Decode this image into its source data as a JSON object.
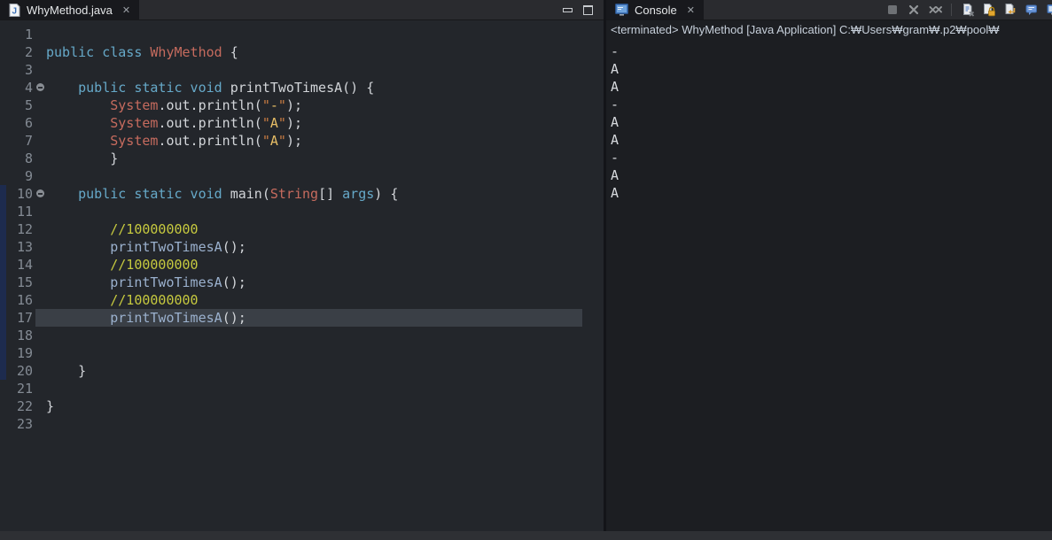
{
  "colors": {
    "keyword": "#66A9C9",
    "type": "#C66B5E",
    "plain": "#D2D5D9",
    "string": "#E7BE66",
    "string_quote": "#C97C43",
    "comment": "#C6C93F",
    "method_call": "#9BB1CE",
    "current_line": "#3A3F46",
    "range_indicator": "#1D2B4E"
  },
  "editor": {
    "tab_title": "WhyMethod.java",
    "tab_close": "✕",
    "window_controls": [
      "minimize",
      "maximize"
    ],
    "highlight_line": 17,
    "range": {
      "from": 10,
      "to": 20
    },
    "lines": [
      {
        "n": 1,
        "tk": []
      },
      {
        "n": 2,
        "tk": [
          [
            "kw",
            "public class "
          ],
          [
            "ty",
            "WhyMethod "
          ],
          [
            "pl",
            "{"
          ]
        ]
      },
      {
        "n": 3,
        "tk": []
      },
      {
        "n": 4,
        "fold": true,
        "tk": [
          [
            "pl",
            "    "
          ],
          [
            "kw",
            "public static void "
          ],
          [
            "pl",
            "printTwoTimesA() {"
          ]
        ]
      },
      {
        "n": 5,
        "tk": [
          [
            "pl",
            "        "
          ],
          [
            "ty",
            "System"
          ],
          [
            "pl",
            ".out.println("
          ],
          [
            "qt",
            "\""
          ],
          [
            "st",
            "-"
          ],
          [
            "qt",
            "\""
          ],
          [
            "pl",
            ");"
          ]
        ]
      },
      {
        "n": 6,
        "tk": [
          [
            "pl",
            "        "
          ],
          [
            "ty",
            "System"
          ],
          [
            "pl",
            ".out.println("
          ],
          [
            "qt",
            "\""
          ],
          [
            "st",
            "A"
          ],
          [
            "qt",
            "\""
          ],
          [
            "pl",
            ");"
          ]
        ]
      },
      {
        "n": 7,
        "tk": [
          [
            "pl",
            "        "
          ],
          [
            "ty",
            "System"
          ],
          [
            "pl",
            ".out.println("
          ],
          [
            "qt",
            "\""
          ],
          [
            "st",
            "A"
          ],
          [
            "qt",
            "\""
          ],
          [
            "pl",
            ");"
          ]
        ]
      },
      {
        "n": 8,
        "tk": [
          [
            "pl",
            "        }"
          ]
        ]
      },
      {
        "n": 9,
        "tk": []
      },
      {
        "n": 10,
        "fold": true,
        "tk": [
          [
            "pl",
            "    "
          ],
          [
            "kw",
            "public static void "
          ],
          [
            "pl",
            "main("
          ],
          [
            "ty",
            "String"
          ],
          [
            "pl",
            "[] "
          ],
          [
            "kw",
            "args"
          ],
          [
            "pl",
            ") {"
          ]
        ]
      },
      {
        "n": 11,
        "tk": []
      },
      {
        "n": 12,
        "tk": [
          [
            "pl",
            "        "
          ],
          [
            "cm",
            "//100000000"
          ]
        ]
      },
      {
        "n": 13,
        "tk": [
          [
            "pl",
            "        "
          ],
          [
            "ca",
            "printTwoTimesA"
          ],
          [
            "pl",
            "();"
          ]
        ]
      },
      {
        "n": 14,
        "tk": [
          [
            "pl",
            "        "
          ],
          [
            "cm",
            "//100000000"
          ]
        ]
      },
      {
        "n": 15,
        "tk": [
          [
            "pl",
            "        "
          ],
          [
            "ca",
            "printTwoTimesA"
          ],
          [
            "pl",
            "();"
          ]
        ]
      },
      {
        "n": 16,
        "tk": [
          [
            "pl",
            "        "
          ],
          [
            "cm",
            "//100000000"
          ]
        ]
      },
      {
        "n": 17,
        "tk": [
          [
            "pl",
            "        "
          ],
          [
            "ca",
            "printTwoTimesA"
          ],
          [
            "pl",
            "();"
          ]
        ]
      },
      {
        "n": 18,
        "tk": []
      },
      {
        "n": 19,
        "tk": []
      },
      {
        "n": 20,
        "tk": [
          [
            "pl",
            "    }"
          ]
        ]
      },
      {
        "n": 21,
        "tk": []
      },
      {
        "n": 22,
        "tk": [
          [
            "pl",
            "}"
          ]
        ]
      },
      {
        "n": 23,
        "tk": []
      }
    ]
  },
  "console": {
    "tab_title": "Console",
    "tab_close": "✕",
    "header": "<terminated> WhyMethod [Java Application] C:₩Users₩gram₩.p2₩pool₩",
    "output": [
      "-",
      "A",
      "A",
      "-",
      "A",
      "A",
      "-",
      "A",
      "A"
    ],
    "toolbar_icons": [
      "terminate",
      "remove-launch",
      "remove-all-terminated",
      "separator",
      "clear-console",
      "scroll-lock",
      "word-wrap",
      "pin-console",
      "open-console"
    ]
  }
}
